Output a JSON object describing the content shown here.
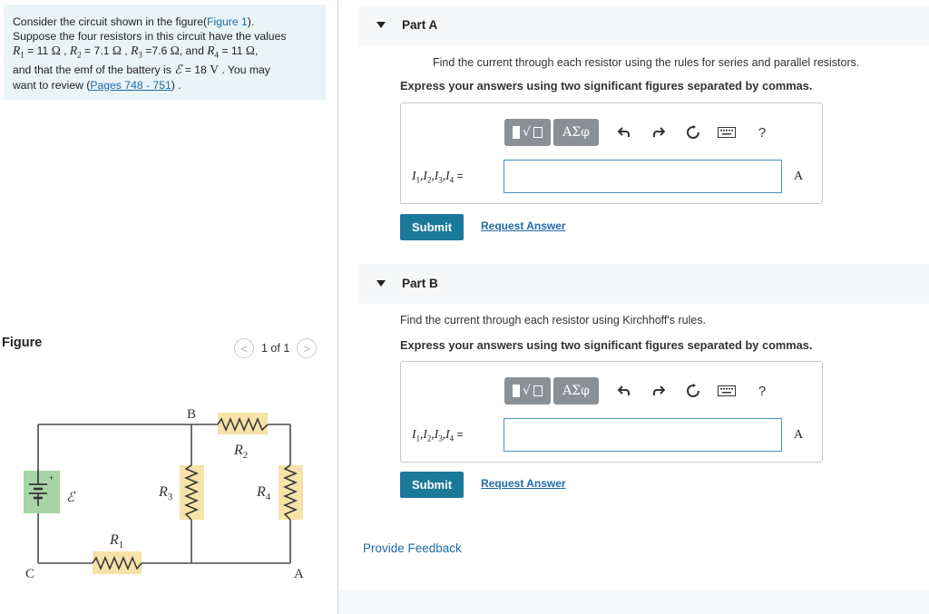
{
  "problem": {
    "line1_pre": "Consider the circuit shown in the figure(",
    "figure_link": "Figure 1",
    "line1_post": ").",
    "line2": "Suppose the four resistors in this circuit have the values",
    "r1": "R",
    "r1_sub": "1",
    "r1_val": " = 11 ",
    "r2": "R",
    "r2_sub": "2",
    "r2_val": " = 7.1 ",
    "r3": "R",
    "r3_sub": "3",
    "r3_val": " =7.6 ",
    "r4": "R",
    "r4_sub": "4",
    "r4_val": " = 11 ",
    "ohm": "Ω",
    "and": ", and ",
    "comma": " , ",
    "line4_pre": "and that the emf of the battery is ",
    "emf_symbol": "ℰ",
    "emf_val": " = 18 ",
    "volt": "V",
    "line4_post": " . You may",
    "line5_pre": "want to review (",
    "pages_link": "Pages 748 - 751",
    "line5_post": ") ."
  },
  "figure": {
    "label": "Figure",
    "pager_text": "1 of 1",
    "prev_glyph": "<",
    "next_glyph": ">",
    "labels": {
      "B": "B",
      "C": "C",
      "A": "A",
      "R1": "R",
      "R1_sub": "1",
      "R2": "R",
      "R2_sub": "2",
      "R3": "R",
      "R3_sub": "3",
      "R4": "R",
      "R4_sub": "4",
      "emf": "ℰ"
    }
  },
  "partA": {
    "title": "Part A",
    "instruction": "Find the current through each resistor using the rules for series and parallel resistors.",
    "format": "Express your answers using two significant figures separated by commas.",
    "label_I": "I",
    "eq": " =",
    "input_value": "",
    "unit": "A",
    "submit": "Submit",
    "request": "Request Answer"
  },
  "partB": {
    "title": "Part B",
    "instruction": "Find the current through each resistor using Kirchhoff's rules.",
    "format": "Express your answers using two significant figures separated by commas.",
    "label_I": "I",
    "eq": " =",
    "input_value": "",
    "unit": "A",
    "submit": "Submit",
    "request": "Request Answer"
  },
  "toolbar": {
    "greek": "ΑΣφ",
    "help": "?",
    "icons": [
      "template-icon",
      "greek-symbols-icon",
      "undo-icon",
      "redo-icon",
      "reset-icon",
      "keyboard-icon",
      "help-icon"
    ]
  },
  "feedback": "Provide Feedback",
  "colors": {
    "accent": "#1b7a99",
    "link": "#1f6aa8",
    "problem_bg": "#e9f4f7",
    "battery_bg": "#a8d5a6",
    "resistor_bg": "#f5e3a9"
  }
}
